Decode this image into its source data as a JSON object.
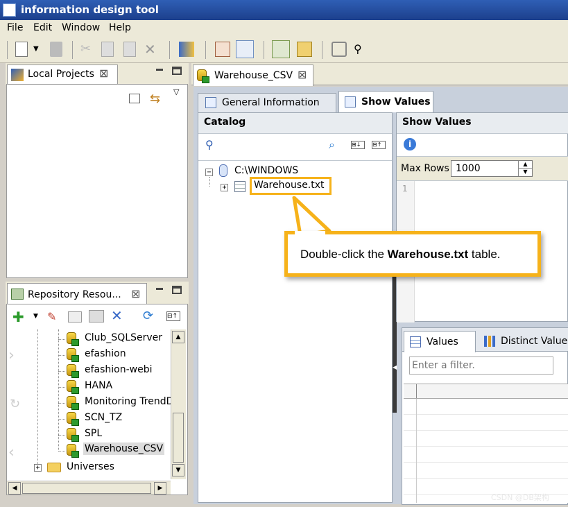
{
  "app": {
    "title": "information design tool"
  },
  "menu": [
    "File",
    "Edit",
    "Window",
    "Help"
  ],
  "local_projects": {
    "tab_label": "Local Projects"
  },
  "repository": {
    "tab_label": "Repository Resou...",
    "items": [
      "Club_SQLServer",
      "efashion",
      "efashion-webi",
      "HANA",
      "Monitoring TrendDl",
      "SCN_TZ",
      "SPL",
      "Warehouse_CSV"
    ],
    "folder": "Universes"
  },
  "editor": {
    "tab_label": "Warehouse_CSV",
    "subtabs": {
      "general": "General Information",
      "show_values": "Show Values"
    },
    "catalog": {
      "header": "Catalog",
      "root": "C:\\WINDOWS",
      "table": "Warehouse.txt"
    },
    "show_values": {
      "header": "Show Values",
      "max_rows_label": "Max Rows",
      "max_rows_value": "1000",
      "line_number": "1"
    },
    "values_tabs": {
      "values": "Values",
      "distinct": "Distinct Values"
    },
    "filter_placeholder": "Enter a filter."
  },
  "callout": {
    "prefix": "Double-click the ",
    "bold": "Warehouse.txt",
    "suffix": " table."
  },
  "watermark": "CSDN @DB架构",
  "colors": {
    "accent": "#f6b21a",
    "titlebar": "#1c3f8c",
    "selected_item": "#dcdcdc"
  }
}
